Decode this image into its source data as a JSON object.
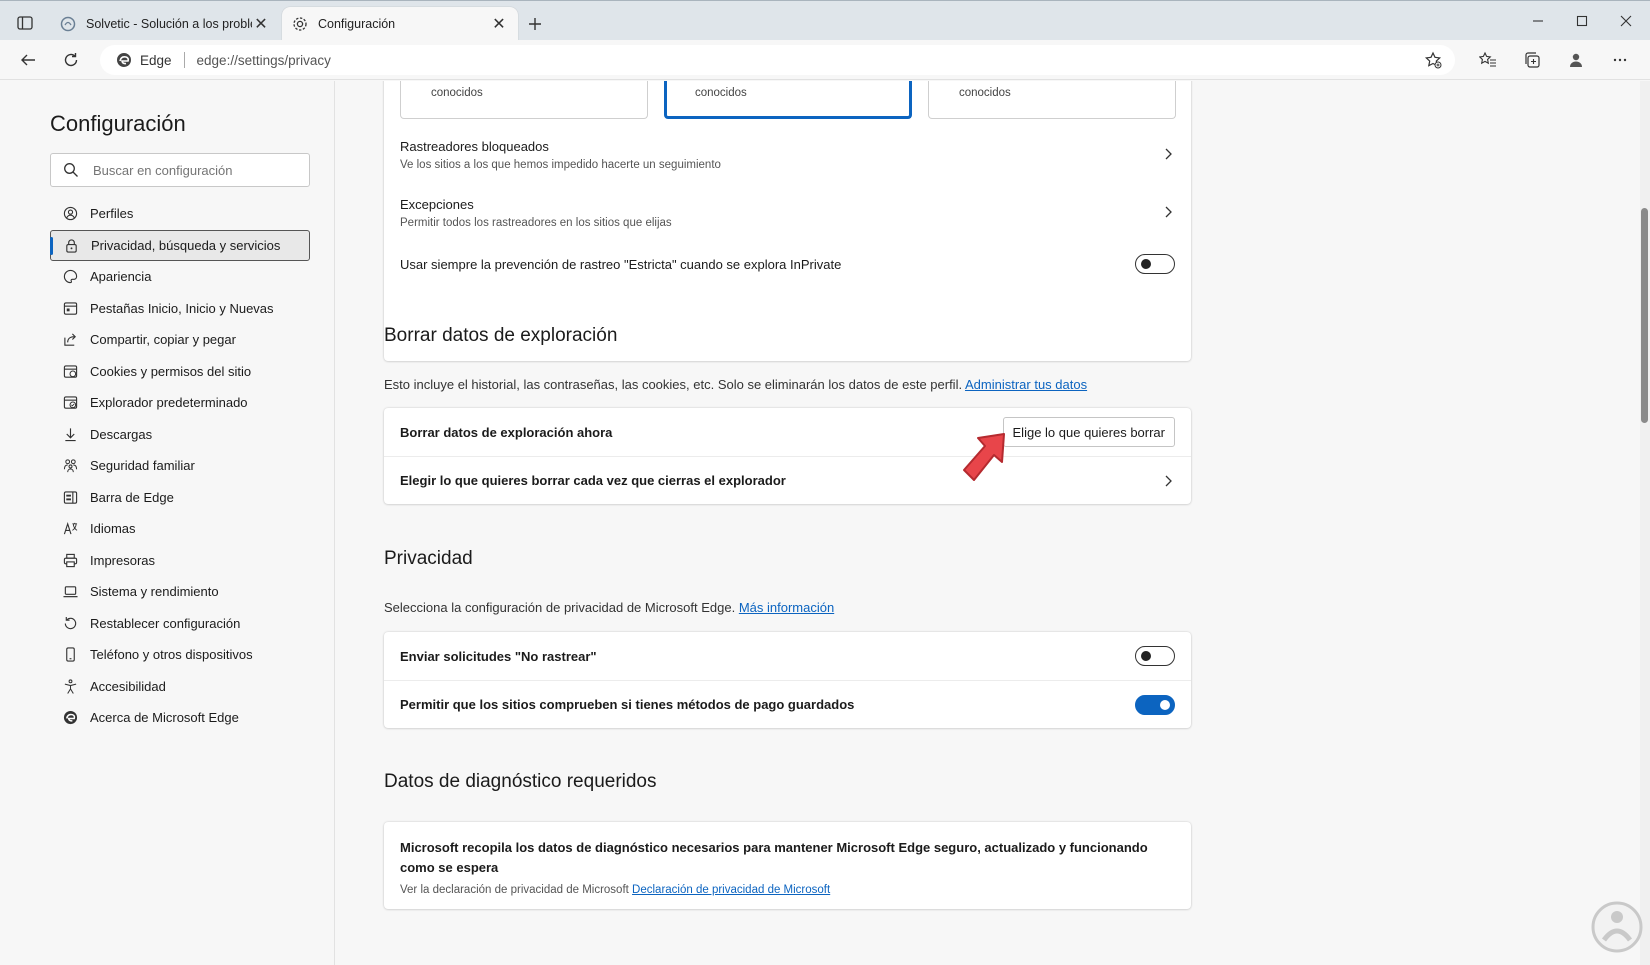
{
  "tabs": [
    {
      "title": "Solvetic - Solución a los problemas",
      "close": "✕"
    },
    {
      "title": "Configuración",
      "close": "✕"
    }
  ],
  "address": {
    "site": "Edge",
    "url": "edge://settings/privacy"
  },
  "sidebar": {
    "title": "Configuración",
    "search_placeholder": "Buscar en configuración",
    "items": [
      {
        "label": "Perfiles",
        "icon": "profile-icon"
      },
      {
        "label": "Privacidad, búsqueda y servicios",
        "icon": "lock-icon",
        "selected": true
      },
      {
        "label": "Apariencia",
        "icon": "palette-icon"
      },
      {
        "label": "Pestañas Inicio, Inicio y Nuevas",
        "icon": "window-icon"
      },
      {
        "label": "Compartir, copiar y pegar",
        "icon": "share-icon"
      },
      {
        "label": "Cookies y permisos del sitio",
        "icon": "cookie-permissions-icon"
      },
      {
        "label": "Explorador predeterminado",
        "icon": "default-browser-icon"
      },
      {
        "label": "Descargas",
        "icon": "download-icon"
      },
      {
        "label": "Seguridad familiar",
        "icon": "family-icon"
      },
      {
        "label": "Barra de Edge",
        "icon": "edge-bar-icon"
      },
      {
        "label": "Idiomas",
        "icon": "language-icon"
      },
      {
        "label": "Impresoras",
        "icon": "printer-icon"
      },
      {
        "label": "Sistema y rendimiento",
        "icon": "laptop-icon"
      },
      {
        "label": "Restablecer configuración",
        "icon": "reset-icon"
      },
      {
        "label": "Teléfono y otros dispositivos",
        "icon": "phone-icon"
      },
      {
        "label": "Accesibilidad",
        "icon": "accessibility-icon"
      },
      {
        "label": "Acerca de Microsoft Edge",
        "icon": "edge-logo-icon"
      }
    ]
  },
  "tracking": {
    "tiles": [
      "conocidos",
      "conocidos",
      "conocidos"
    ],
    "blocked_title": "Rastreadores bloqueados",
    "blocked_sub": "Ve los sitios a los que hemos impedido hacerte un seguimiento",
    "exceptions_title": "Excepciones",
    "exceptions_sub": "Permitir todos los rastreadores en los sitios que elijas",
    "strict_label": "Usar siempre la prevención de rastreo \"Estricta\" cuando se explora InPrivate"
  },
  "clear": {
    "title": "Borrar datos de exploración",
    "desc": "Esto incluye el historial, las contraseñas, las cookies, etc. Solo se eliminarán los datos de este perfil.",
    "desc_link": "Administrar tus datos",
    "now_label": "Borrar datos de exploración ahora",
    "choose_button": "Elige lo que quieres borrar",
    "on_close_label": "Elegir lo que quieres borrar cada vez que cierras el explorador"
  },
  "privacy": {
    "title": "Privacidad",
    "desc": "Selecciona la configuración de privacidad de Microsoft Edge.",
    "desc_link": "Más información",
    "dnt_label": "Enviar solicitudes \"No rastrear\"",
    "payment_label": "Permitir que los sitios comprueben si tienes métodos de pago guardados"
  },
  "diagnostics": {
    "title": "Datos de diagnóstico requeridos",
    "text": "Microsoft recopila los datos de diagnóstico necesarios para mantener Microsoft Edge seguro, actualizado y funcionando como se espera",
    "sub": "Ver la declaración de privacidad de Microsoft",
    "sub_link": "Declaración de privacidad de Microsoft"
  },
  "colors": {
    "accent": "#0c64c0",
    "annotation_arrow": "#e8454a"
  }
}
